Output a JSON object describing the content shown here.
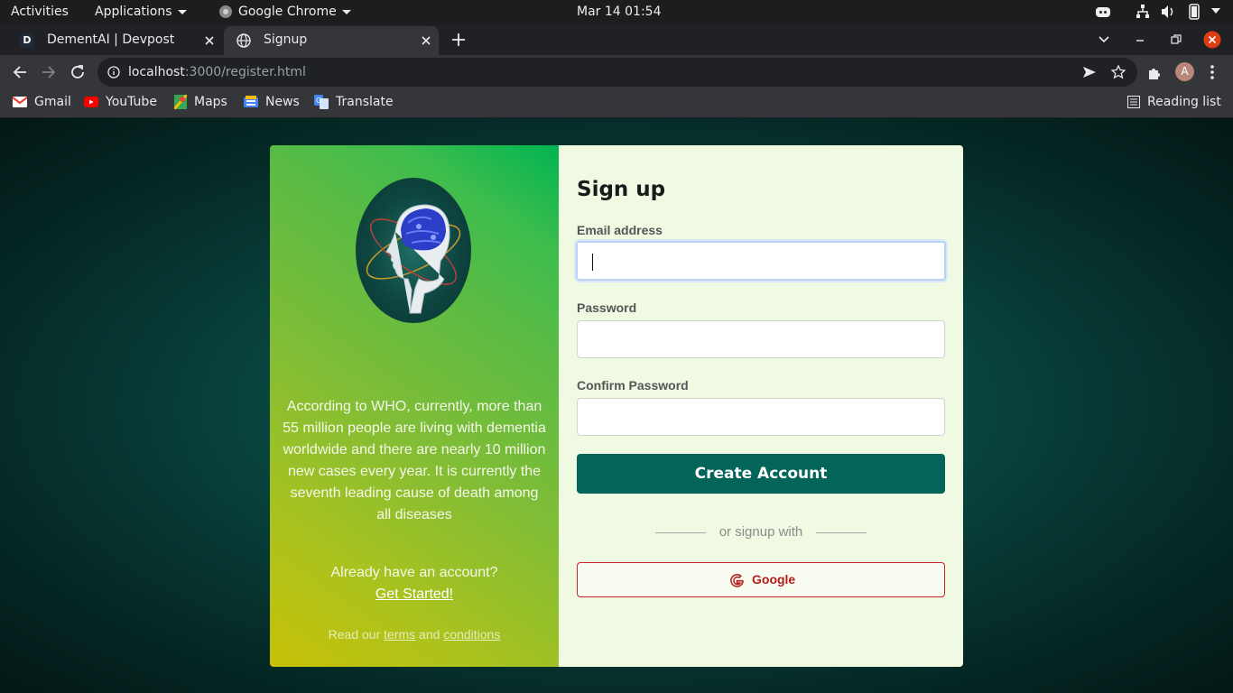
{
  "system_bar": {
    "activities": "Activities",
    "applications": "Applications",
    "app_name": "Google Chrome",
    "clock": "Mar 14  01:54"
  },
  "browser": {
    "tabs": [
      {
        "title": "DementAI | Devpost",
        "favicon_letter": "D",
        "active": false
      },
      {
        "title": "Signup",
        "active": true
      }
    ],
    "url_host": "localhost",
    "url_rest": ":3000/register.html",
    "avatar_letter": "A",
    "bookmarks": [
      {
        "label": "Gmail",
        "icon": "gmail-icon"
      },
      {
        "label": "YouTube",
        "icon": "youtube-icon"
      },
      {
        "label": "Maps",
        "icon": "maps-icon"
      },
      {
        "label": "News",
        "icon": "news-icon"
      },
      {
        "label": "Translate",
        "icon": "translate-icon"
      }
    ],
    "reading_list": "Reading list"
  },
  "page": {
    "info_text": "According to WHO, currently, more than 55 million people are living with dementia worldwide and there are nearly 10 million new cases every year. It is currently the seventh leading cause of death among all diseases",
    "already_text": "Already have an account?",
    "get_started": "Get Started!",
    "terms_prefix": "Read our",
    "terms_link": "terms",
    "terms_and": "and",
    "conditions_link": "conditions",
    "form": {
      "title": "Sign up",
      "email_label": "Email address",
      "email_value": "",
      "password_label": "Password",
      "confirm_label": "Confirm Password",
      "create_button": "Create Account",
      "divider_text": "or signup with",
      "google_button": "Google"
    },
    "colors": {
      "create_button": "#03645a",
      "google_border": "#c8242a",
      "form_bg": "#f0f9e2"
    }
  }
}
